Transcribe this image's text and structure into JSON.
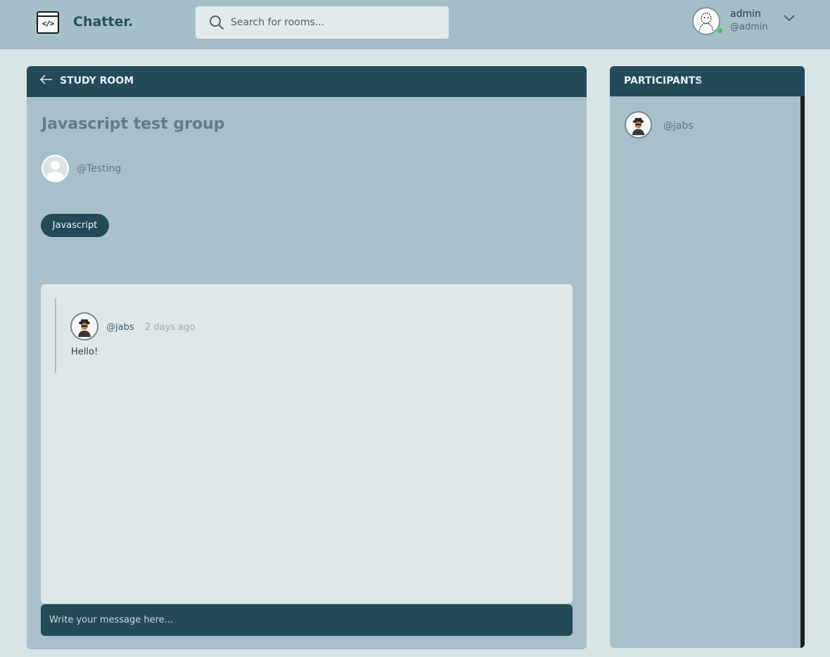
{
  "header": {
    "brand": "Chatter.",
    "search_placeholder": "Search for rooms...",
    "user": {
      "name": "admin",
      "handle": "@admin",
      "status": "online"
    }
  },
  "room": {
    "header_title": "STUDY ROOM",
    "title": "Javascript test group",
    "host": "@Testing",
    "topic": "Javascript",
    "messages": [
      {
        "user": "@jabs",
        "time": "2 days ago",
        "body": "Hello!"
      }
    ],
    "composer_placeholder": "Write your message here..."
  },
  "participants": {
    "title": "PARTICIPANTS",
    "count": "1",
    "items": [
      {
        "handle": "@jabs"
      }
    ]
  },
  "colors": {
    "primary": "#224b57",
    "panel": "#a9bfc9",
    "header_bar": "#a6bec8",
    "background": "#d9e4e6",
    "online": "#3ec94a"
  }
}
